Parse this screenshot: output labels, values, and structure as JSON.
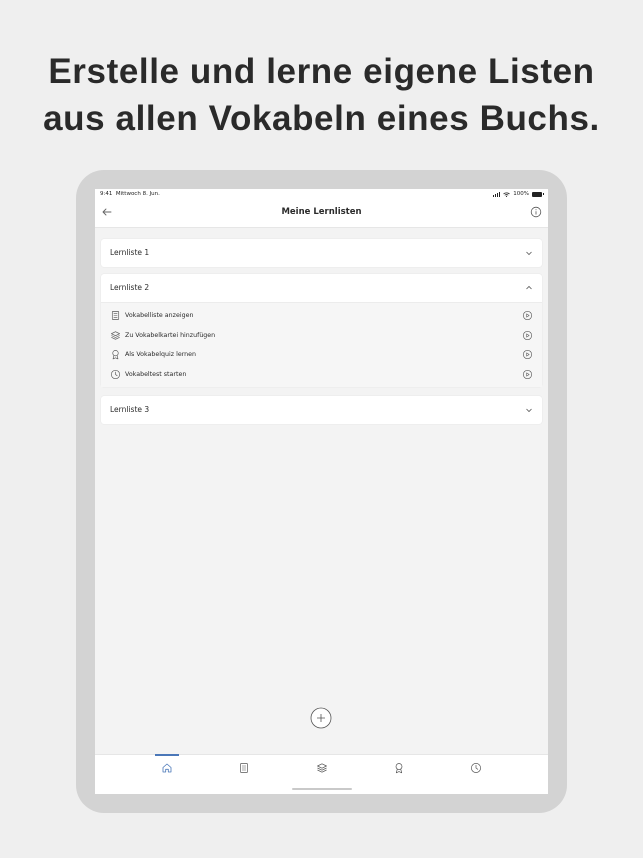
{
  "headline": {
    "line1": "Erstelle und lerne eigene Listen",
    "line2": "aus allen Vokabeln eines Buchs."
  },
  "status_bar": {
    "time": "9:41",
    "date": "Mittwoch 8. Jun.",
    "battery": "100%"
  },
  "nav": {
    "title": "Meine Lernlisten",
    "back_icon": "arrow-left-icon",
    "info_icon": "info-icon"
  },
  "lists": [
    {
      "title": "Lernliste 1",
      "expanded": false
    },
    {
      "title": "Lernliste 2",
      "expanded": true,
      "actions": [
        {
          "label": "Vokabelliste anzeigen",
          "icon": "document-icon"
        },
        {
          "label": "Zu Vokabelkartei hinzufügen",
          "icon": "layers-icon"
        },
        {
          "label": "Als Vokabelquiz lernen",
          "icon": "award-icon"
        },
        {
          "label": "Vokabeltest starten",
          "icon": "clock-icon"
        }
      ]
    },
    {
      "title": "Lernliste 3",
      "expanded": false
    }
  ],
  "fab": {
    "icon": "plus-icon"
  },
  "tabbar": {
    "tabs": [
      {
        "icon": "home-icon",
        "active": true
      },
      {
        "icon": "document-icon",
        "active": false
      },
      {
        "icon": "layers-icon",
        "active": false
      },
      {
        "icon": "award-icon",
        "active": false
      },
      {
        "icon": "clock-icon",
        "active": false
      }
    ]
  },
  "colors": {
    "accent": "#4a77b8",
    "background": "#efefef",
    "device_frame": "#d3d3d3",
    "text": "#2b2b2b"
  }
}
